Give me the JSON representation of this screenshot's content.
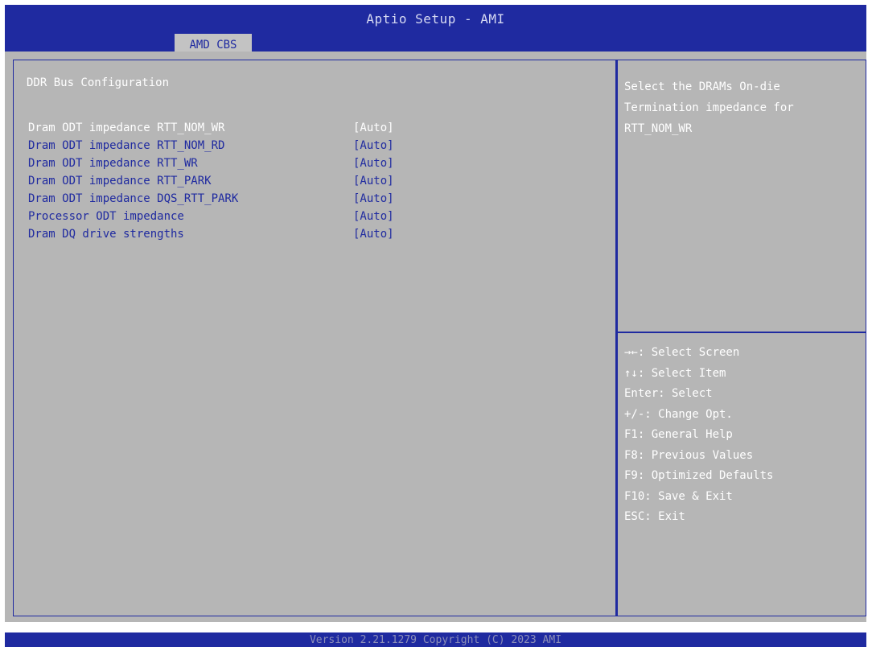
{
  "header": {
    "title": "Aptio Setup - AMI",
    "tab_label": "AMD CBS"
  },
  "main": {
    "section_title": "DDR Bus Configuration",
    "settings": [
      {
        "label": "Dram ODT impedance RTT_NOM_WR",
        "value": "[Auto]",
        "selected": true
      },
      {
        "label": "Dram ODT impedance RTT_NOM_RD",
        "value": "[Auto]",
        "selected": false
      },
      {
        "label": "Dram ODT impedance RTT_WR",
        "value": "[Auto]",
        "selected": false
      },
      {
        "label": "Dram ODT impedance RTT_PARK",
        "value": "[Auto]",
        "selected": false
      },
      {
        "label": "Dram ODT impedance DQS_RTT_PARK",
        "value": "[Auto]",
        "selected": false
      },
      {
        "label": "Processor ODT impedance",
        "value": "[Auto]",
        "selected": false
      },
      {
        "label": "Dram DQ drive strengths",
        "value": "[Auto]",
        "selected": false
      }
    ]
  },
  "help": {
    "text": "Select the DRAMs On-die\nTermination impedance for\nRTT_NOM_WR",
    "keys": [
      "→←: Select Screen",
      "↑↓: Select Item",
      "Enter: Select",
      "+/-: Change Opt.",
      "F1: General Help",
      "F8: Previous Values",
      "F9: Optimized Defaults",
      "F10: Save & Exit",
      "ESC: Exit"
    ]
  },
  "footer": {
    "text": "Version 2.21.1279 Copyright (C) 2023 AMI"
  },
  "colors": {
    "bar": "#1f2aa0",
    "panel": "#b6b6b6",
    "selected_text": "#ffffff",
    "item_text": "#1f2aa0"
  }
}
